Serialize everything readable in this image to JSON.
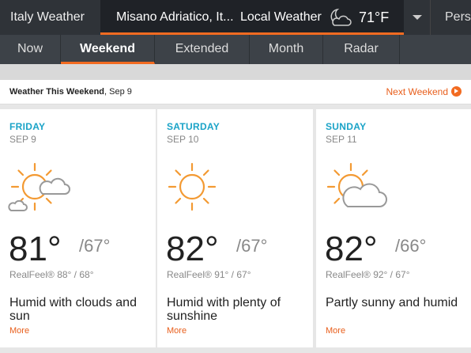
{
  "topbar": {
    "region": "Italy Weather",
    "location": "Misano Adriatico, It...",
    "local_weather_label": "Local Weather",
    "current_icon": "partly-cloudy-night-icon",
    "current_temp": "71°F",
    "personal_label": "Perso"
  },
  "subnav": {
    "tabs": [
      {
        "label": "Now"
      },
      {
        "label": "Weekend"
      },
      {
        "label": "Extended"
      },
      {
        "label": "Month"
      },
      {
        "label": "Radar"
      }
    ],
    "active": "Weekend"
  },
  "header": {
    "title": "Weather This Weekend",
    "date": ", Sep 9",
    "next_label": "Next Weekend"
  },
  "days": [
    {
      "name": "FRIDAY",
      "date": "SEP 9",
      "icon": "sun-with-clouds-icon",
      "high": "81°",
      "low": "/67°",
      "realfeel": "RealFeel® 88° / 68°",
      "description": "Humid with clouds and sun",
      "more": "More"
    },
    {
      "name": "SATURDAY",
      "date": "SEP 10",
      "icon": "sunny-icon",
      "high": "82°",
      "low": "/67°",
      "realfeel": "RealFeel® 91° / 67°",
      "description": "Humid with plenty of sunshine",
      "more": "More"
    },
    {
      "name": "SUNDAY",
      "date": "SEP 11",
      "icon": "partly-sunny-icon",
      "high": "82°",
      "low": "/66°",
      "realfeel": "RealFeel® 92° / 67°",
      "description": "Partly sunny and humid",
      "more": "More"
    }
  ],
  "colors": {
    "accent": "#f26b21",
    "day_name": "#1aa3c7",
    "topbar": "#2f3338",
    "subnav": "#3d4248"
  }
}
